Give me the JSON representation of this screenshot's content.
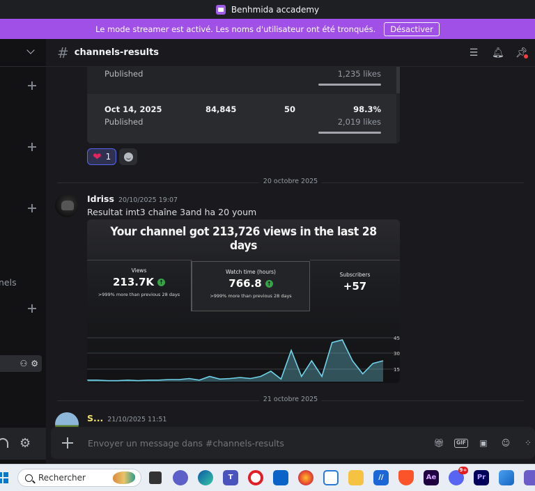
{
  "titlebar": {
    "app_title": "Benhmida accademy"
  },
  "banner": {
    "text": "Le mode streamer est activé. Les noms d'utilisateur ont été tronqués.",
    "button": "Désactiver"
  },
  "sidebar": {
    "partial_channel_label": "nels"
  },
  "channel": {
    "name": "channels-results"
  },
  "embed_table": {
    "rows": [
      {
        "status": "Published",
        "likes": "1,235 likes"
      },
      {
        "date": "Oct 14, 2025",
        "views": "84,845",
        "subs": "50",
        "pct": "98.3%",
        "status": "Published",
        "likes": "2,019 likes"
      }
    ]
  },
  "reactions": {
    "heart_count": "1"
  },
  "dividers": {
    "d1": "20 octobre 2025",
    "d2": "21 octobre 2025"
  },
  "messages": [
    {
      "author": "Idriss",
      "timestamp": "20/10/2025 19:07",
      "text": "Resultat imt3 chaîne 3and ha 20 youm"
    },
    {
      "author": "S...",
      "timestamp": "21/10/2025 11:51"
    }
  ],
  "photo": {
    "title": "Your channel got 213,726 views in the last 28 days",
    "stats": [
      {
        "label": "Views",
        "value": "213.7K",
        "sub": ">999% more than previous 28 days"
      },
      {
        "label": "Watch time (hours)",
        "value": "766.8",
        "sub": ">999% more than previous 28 days"
      },
      {
        "label": "Subscribers",
        "value": "+57"
      }
    ],
    "chart_data": {
      "type": "area",
      "y_tick_labels": [
        "45",
        "30",
        "15"
      ],
      "relative_values": [
        0.03,
        0.03,
        0.02,
        0.02,
        0.03,
        0.02,
        0.03,
        0.03,
        0.04,
        0.04,
        0.06,
        0.03,
        0.1,
        0.05,
        0.06,
        0.08,
        0.06,
        0.1,
        0.2,
        0.05,
        0.6,
        0.1,
        0.4,
        0.1,
        0.75,
        0.8,
        0.4,
        0.15,
        0.35,
        0.4
      ],
      "grid": true
    }
  },
  "composer": {
    "placeholder": "Envoyer un message dans #channels-results"
  },
  "taskbar": {
    "search_label": "Rechercher",
    "notification_badge": "9+"
  }
}
